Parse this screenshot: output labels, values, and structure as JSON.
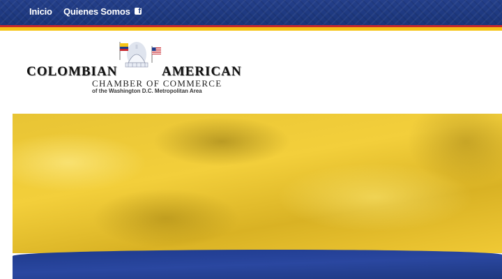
{
  "nav": {
    "inicio": "Inicio",
    "quienes": "Quienes Somos",
    "facebook_icon": "facebook-icon"
  },
  "logo": {
    "word_left": "COLOMBIAN",
    "word_right": "AMERICAN",
    "line2": "CHAMBER OF COMMERCE",
    "line3": "of the Washington D.C. Metropolitan Area"
  },
  "colors": {
    "nav_blue": "#1d3a82",
    "stripe_red": "#c8282e",
    "stripe_yellow": "#f6c417",
    "flag_yellow": "#f0c935",
    "flag_blue": "#1e3a8c"
  },
  "hero": {
    "image": "colombian-flag"
  }
}
